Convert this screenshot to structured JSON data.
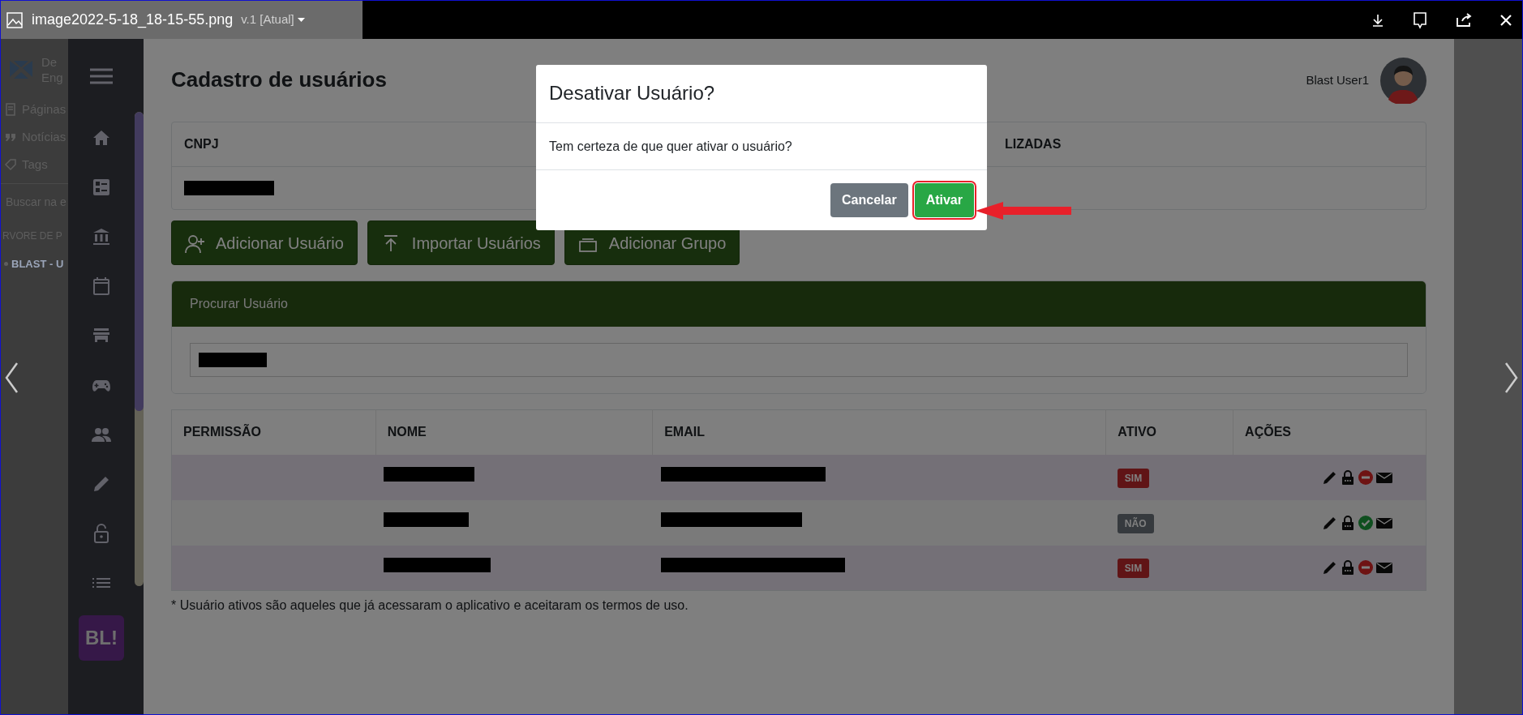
{
  "viewer": {
    "file_name": "image2022-5-18_18-15-55.png",
    "version": "v.1 [Atual]"
  },
  "background_page": {
    "logo_lines": [
      "De",
      "Eng"
    ],
    "items": [
      "Páginas",
      "Notícias",
      "Tags"
    ],
    "search_placeholder": "Buscar na e",
    "tree_heading": "RVORE DE P",
    "tree_item": "BLAST - U"
  },
  "app": {
    "logo": "BL!",
    "page_title": "Cadastro de usuários",
    "user_name": "Blast User1",
    "info_card": {
      "columns": [
        "CNPJ",
        "LIZADAS"
      ]
    },
    "buttons": [
      {
        "label": "Adicionar Usuário",
        "kind": "add-user"
      },
      {
        "label": "Importar Usuários",
        "kind": "import"
      },
      {
        "label": "Adicionar Grupo",
        "kind": "add-group"
      }
    ],
    "search_card": {
      "title": "Procurar Usuário"
    },
    "table": {
      "columns": [
        "PERMISSÃO",
        "NOME",
        "EMAIL",
        "ATIVO",
        "AÇÕES"
      ],
      "rows": [
        {
          "ativo": "SIM",
          "active": true
        },
        {
          "ativo": "NÃO",
          "active": false
        },
        {
          "ativo": "SIM",
          "active": true
        }
      ]
    },
    "footnote": "* Usuário ativos são aqueles que já acessaram o aplicativo e aceitaram os termos de uso."
  },
  "modal": {
    "title": "Desativar Usuário?",
    "message": "Tem certeza de que quer ativar o usuário?",
    "buttons": [
      {
        "label": "Cancelar",
        "kind": "secondary",
        "highlighted": false
      },
      {
        "label": "Ativar",
        "kind": "success",
        "highlighted": true
      }
    ]
  }
}
